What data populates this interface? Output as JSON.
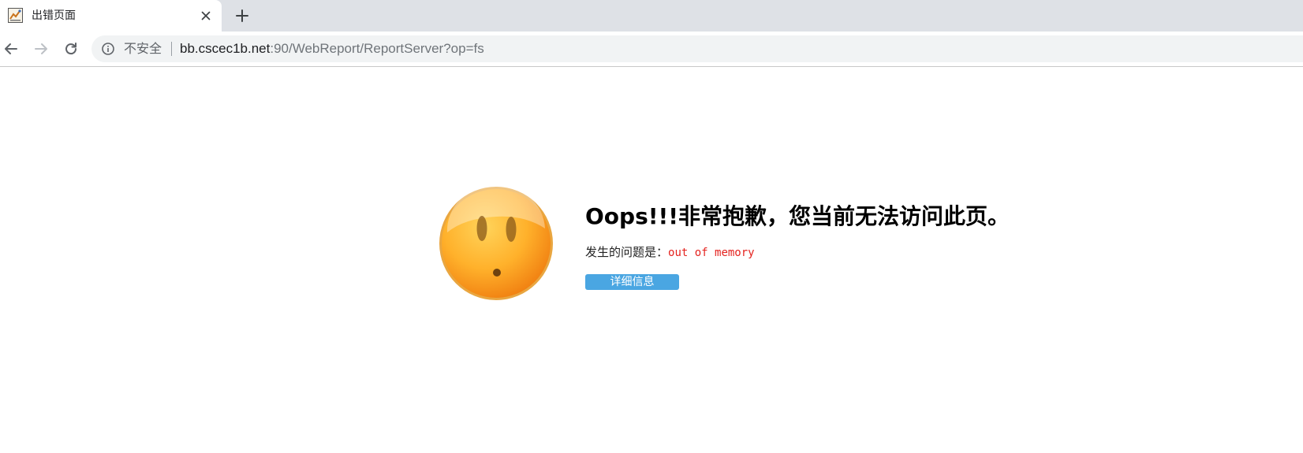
{
  "tab": {
    "title": "出错页面",
    "favicon": "report-favicon",
    "close_icon": "close-icon",
    "new_tab_icon": "plus-icon"
  },
  "toolbar": {
    "back_icon": "arrow-left-icon",
    "forward_icon": "arrow-right-icon",
    "reload_icon": "reload-icon"
  },
  "omnibox": {
    "info_icon": "info-icon",
    "security_label": "不安全",
    "url_host": "bb.cscec1b.net",
    "url_rest": ":90/WebReport/ReportServer?op=fs"
  },
  "error": {
    "title": "Oops!!!非常抱歉，您当前无法访问此页。",
    "problem_label": "发生的问题是：",
    "problem_value": "out of memory",
    "details_button": "详细信息",
    "illustration": "sad-face-icon"
  },
  "colors": {
    "tabstrip_bg": "#dee1e6",
    "omnibox_bg": "#f1f3f4",
    "error_text": "#e4231f",
    "button_bg": "#4aa6e2"
  }
}
